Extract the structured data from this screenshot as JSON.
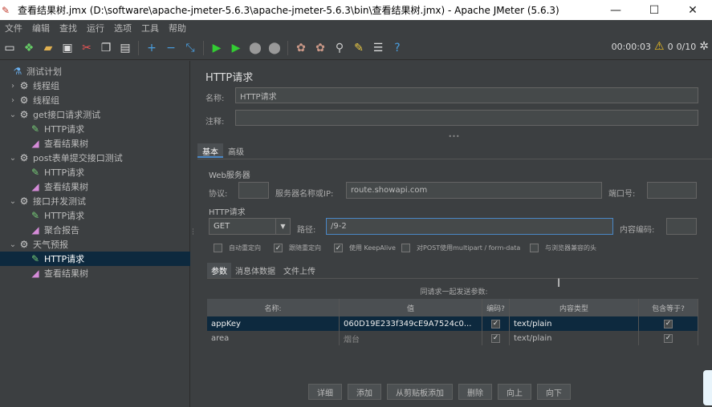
{
  "window": {
    "title": "查看结果树.jmx (D:\\software\\apache-jmeter-5.6.3\\apache-jmeter-5.6.3\\bin\\查看结果树.jmx) - Apache JMeter (5.6.3)"
  },
  "menu": [
    "文件",
    "编辑",
    "查找",
    "运行",
    "选项",
    "工具",
    "帮助"
  ],
  "toolbar_status": {
    "time": "00:00:03",
    "warnings": "0",
    "threads": "0/10"
  },
  "tree": [
    {
      "label": "测试计划",
      "icon": "flask-icon",
      "depth": 0,
      "arrow": ""
    },
    {
      "label": "线程组",
      "icon": "gear-icon",
      "depth": 1,
      "arrow": "›"
    },
    {
      "label": "线程组",
      "icon": "gear-icon",
      "depth": 1,
      "arrow": "›"
    },
    {
      "label": "get接口请求测试",
      "icon": "gear-icon",
      "depth": 1,
      "arrow": "⌄"
    },
    {
      "label": "HTTP请求",
      "icon": "pipette-icon",
      "depth": 2,
      "arrow": ""
    },
    {
      "label": "查看结果树",
      "icon": "chart-icon",
      "depth": 2,
      "arrow": ""
    },
    {
      "label": "post表单提交接口测试",
      "icon": "gear-icon",
      "depth": 1,
      "arrow": "⌄"
    },
    {
      "label": "HTTP请求",
      "icon": "pipette-icon",
      "depth": 2,
      "arrow": ""
    },
    {
      "label": "查看结果树",
      "icon": "chart-icon",
      "depth": 2,
      "arrow": ""
    },
    {
      "label": "接口并发测试",
      "icon": "gear-icon",
      "depth": 1,
      "arrow": "⌄"
    },
    {
      "label": "HTTP请求",
      "icon": "pipette-icon",
      "depth": 2,
      "arrow": ""
    },
    {
      "label": "聚合报告",
      "icon": "chart-icon",
      "depth": 2,
      "arrow": ""
    },
    {
      "label": "天气预报",
      "icon": "gear-icon",
      "depth": 1,
      "arrow": "⌄"
    },
    {
      "label": "HTTP请求",
      "icon": "pipette-icon",
      "depth": 2,
      "arrow": "",
      "selected": true
    },
    {
      "label": "查看结果树",
      "icon": "chart-icon",
      "depth": 2,
      "arrow": ""
    }
  ],
  "panel": {
    "title": "HTTP请求",
    "name_label": "名称:",
    "name_value": "HTTP请求",
    "comment_label": "注释:",
    "comment_value": "",
    "tabs": [
      "基本",
      "高级"
    ],
    "web_server_label": "Web服务器",
    "protocol_label": "协议:",
    "protocol_value": "",
    "server_label": "服务器名称或IP:",
    "server_value": "route.showapi.com",
    "port_label": "端口号:",
    "port_value": "",
    "http_request_label": "HTTP请求",
    "method_value": "GET",
    "path_label": "路径:",
    "path_value": "/9-2",
    "encoding_label": "内容编码:",
    "encoding_value": "",
    "checkboxes": [
      {
        "label": "自动重定向",
        "checked": false
      },
      {
        "label": "跟随重定向",
        "checked": true
      },
      {
        "label": "使用 KeepAlive",
        "checked": true
      },
      {
        "label": "对POST使用multipart / form-data",
        "checked": false
      },
      {
        "label": "与浏览器兼容的头",
        "checked": false
      }
    ],
    "subtabs": [
      "参数",
      "消息体数据",
      "文件上传"
    ],
    "table_caption": "同请求一起发送参数:",
    "table_headers": [
      "名称:",
      "值",
      "编码?",
      "内容类型",
      "包含等于?"
    ],
    "table_rows": [
      {
        "name": "appKey",
        "value": "060D19E233f349cE9A7524c0...",
        "encode": true,
        "content_type": "text/plain",
        "include_equals": true
      },
      {
        "name": "area",
        "value": "烟台",
        "encode": true,
        "content_type": "text/plain",
        "include_equals": true
      }
    ],
    "buttons": [
      "详细",
      "添加",
      "从剪贴板添加",
      "删除",
      "向上",
      "向下"
    ]
  }
}
